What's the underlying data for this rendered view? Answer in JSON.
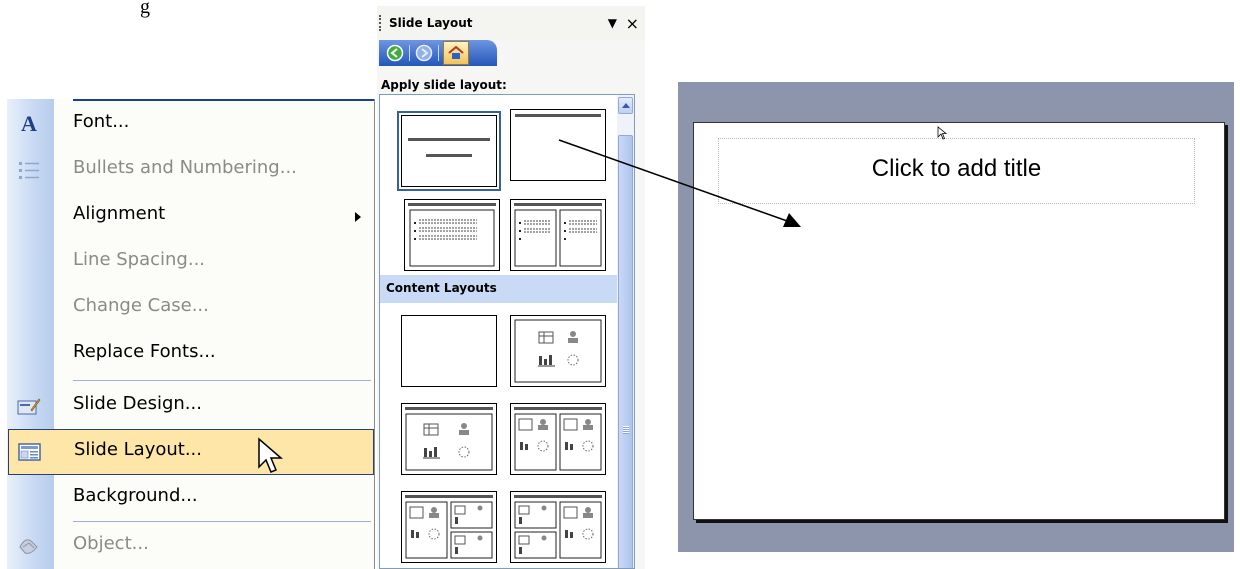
{
  "doc_text": {
    "line1": "g",
    "line2": ""
  },
  "format_menu": {
    "items": [
      {
        "label": "Font...",
        "icon": "font-a-icon",
        "enabled": true
      },
      {
        "label": "Bullets and Numbering...",
        "icon": "bullets-icon",
        "enabled": false
      },
      {
        "label": "Alignment",
        "icon": "",
        "enabled": true,
        "submenu": true
      },
      {
        "label": "Line Spacing...",
        "icon": "",
        "enabled": false
      },
      {
        "label": "Change Case...",
        "icon": "",
        "enabled": false
      },
      {
        "label": "Replace Fonts...",
        "icon": "",
        "enabled": true
      },
      {
        "label": "Slide Design...",
        "icon": "slide-design-icon",
        "enabled": true
      },
      {
        "label": "Slide Layout...",
        "icon": "slide-layout-icon",
        "enabled": true,
        "highlighted": true
      },
      {
        "label": "Background...",
        "icon": "",
        "enabled": true
      },
      {
        "label": "Object...",
        "icon": "object-icon",
        "enabled": false
      }
    ]
  },
  "task_pane": {
    "title": "Slide Layout",
    "dropdown_glyph": "▼",
    "close_glyph": "×",
    "apply_label": "Apply slide layout:",
    "section_label": "Content Layouts"
  },
  "slide": {
    "title_placeholder": "Click to add title"
  },
  "colors": {
    "menu_highlight": "#fde6a8",
    "nav_bar": "#2457b8",
    "section_band": "#c8daf5",
    "slide_frame": "#8d95ad"
  }
}
